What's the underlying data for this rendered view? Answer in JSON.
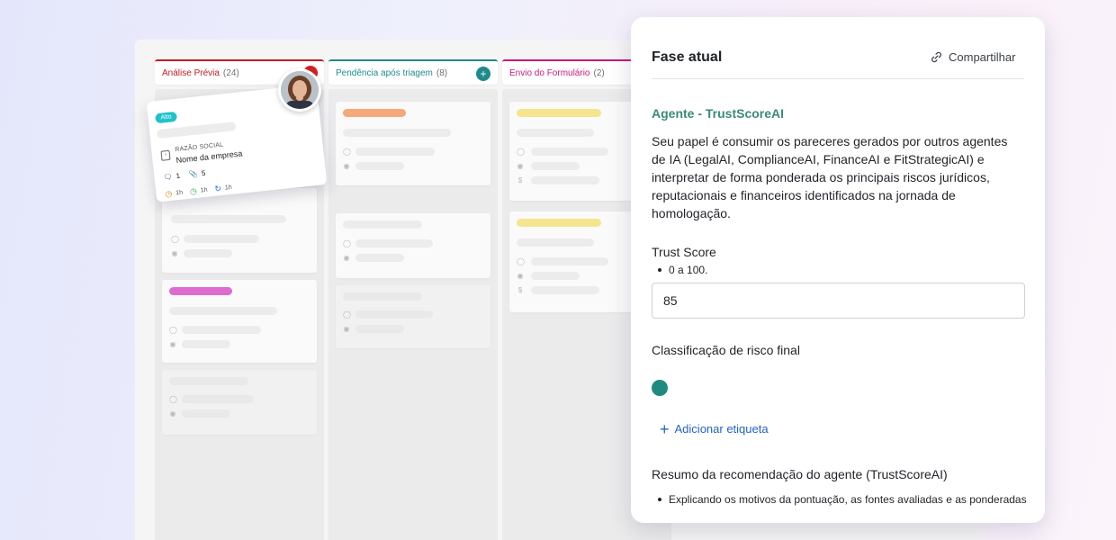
{
  "columns": [
    {
      "title": "Análise Prévia",
      "count": "(24)",
      "color": "#c11c22"
    },
    {
      "title": "Pendência após triagem",
      "count": "(8)",
      "color": "#1f8a8a"
    },
    {
      "title": "Envio do Formulário",
      "count": "(2)",
      "color": "#c8197a"
    }
  ],
  "floating_card": {
    "priority": "Alto",
    "label": "RAZÃO SOCIAL",
    "value": "Nome da empresa",
    "comments": "1",
    "attachments": "5",
    "times": [
      "1h",
      "1h",
      "1h"
    ]
  },
  "panel": {
    "title": "Fase atual",
    "share": "Compartilhar",
    "agent_title": "Agente - TrustScoreAI",
    "description": "Seu papel é consumir os pareceres gerados por outros agentes de IA (LegalAI, ComplianceAI, FinanceAI e FitStrategicAI) e interpretar de forma ponderada os principais riscos jurídicos, reputacionais e financeiros identificados na jornada de homologação.",
    "trust_label": "Trust Score",
    "trust_hint": "0 a 100.",
    "trust_value": "85",
    "risk_label": "Classificação de risco final",
    "add_tag": "Adicionar etiqueta",
    "summary_label": "Resumo da recomendação do agente (TrustScoreAI)",
    "summary_hint": "Explicando os motivos da pontuação, as fontes avaliadas e as ponderadas"
  },
  "colors": {
    "accent_green": "#3c8a78",
    "link_blue": "#2563c9",
    "risk_teal": "#1f8a80"
  }
}
